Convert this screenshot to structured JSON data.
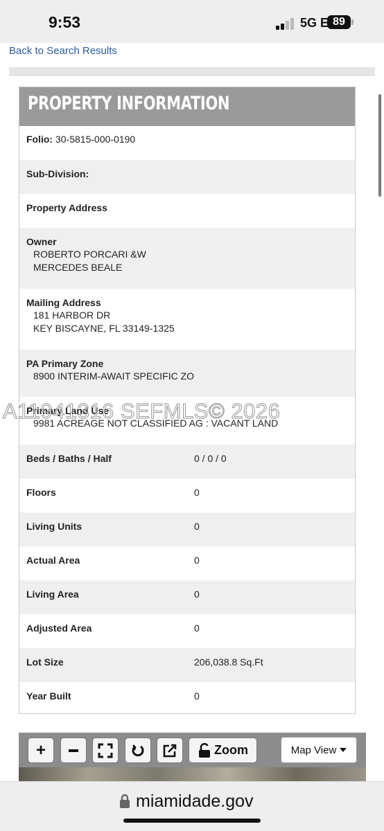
{
  "status_bar": {
    "time": "9:53",
    "network": "5G E",
    "battery": "89"
  },
  "nav": {
    "back_link": "Back to Search Results"
  },
  "panel": {
    "title": "PROPERTY INFORMATION",
    "folio_label": "Folio:",
    "folio_value": "30-5815-000-0190",
    "subdivision_label": "Sub-Division:",
    "property_address_label": "Property Address",
    "owner_label": "Owner",
    "owner_line1": "ROBERTO PORCARI &W",
    "owner_line2": "MERCEDES BEALE",
    "mailing_label": "Mailing Address",
    "mailing_line1": "181 HARBOR DR",
    "mailing_line2": "KEY BISCAYNE, FL 33149-1325",
    "zone_label": "PA Primary Zone",
    "zone_value": "8900 INTERIM-AWAIT SPECIFIC ZO",
    "land_use_label": "Primary Land Use",
    "land_use_value": "9981 ACREAGE NOT CLASSIFIED AG : VACANT LAND",
    "details": [
      {
        "label": "Beds / Baths / Half",
        "value": "0 / 0 / 0"
      },
      {
        "label": "Floors",
        "value": "0"
      },
      {
        "label": "Living Units",
        "value": "0"
      },
      {
        "label": "Actual Area",
        "value": "0"
      },
      {
        "label": "Living Area",
        "value": "0"
      },
      {
        "label": "Adjusted Area",
        "value": "0"
      },
      {
        "label": "Lot Size",
        "value": "206,038.8 Sq.Ft"
      },
      {
        "label": "Year Built",
        "value": "0"
      }
    ]
  },
  "watermark": "A11941316 SEFMLS© 2026",
  "map_toolbar": {
    "zoom_in_label": "+",
    "zoom_label": "Zoom",
    "map_view_label": "Map View"
  },
  "browser": {
    "url": "miamidade.gov"
  }
}
